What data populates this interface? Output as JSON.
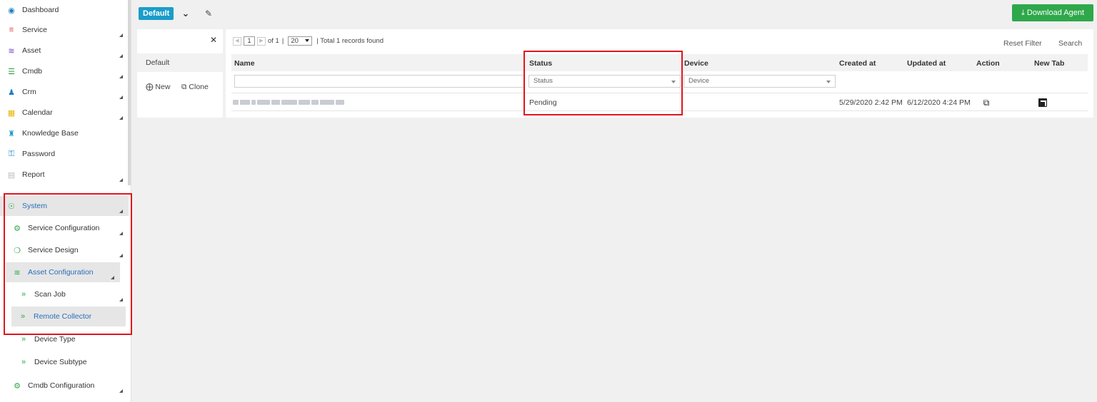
{
  "sidebar": {
    "items": [
      {
        "label": "Dashboard",
        "icon": "dashboard-icon",
        "color": "#1a7fc4"
      },
      {
        "label": "Service",
        "icon": "service-icon",
        "color": "#e23a3a"
      },
      {
        "label": "Asset",
        "icon": "wifi-icon",
        "color": "#7a3fc0"
      },
      {
        "label": "Cmdb",
        "icon": "database-icon",
        "color": "#2a9a3a"
      },
      {
        "label": "Crm",
        "icon": "user-icon",
        "color": "#1a7fc4"
      },
      {
        "label": "Calendar",
        "icon": "calendar-icon",
        "color": "#e8b400"
      },
      {
        "label": "Knowledge Base",
        "icon": "knowledge-icon",
        "color": "#1a9dc9"
      },
      {
        "label": "Password",
        "icon": "key-icon",
        "color": "#1a7fc4"
      },
      {
        "label": "Report",
        "icon": "report-icon",
        "color": "#bbbbbb"
      },
      {
        "label": "System",
        "icon": "globe-icon",
        "color": "#2ea84a"
      },
      {
        "label": "Service Configuration",
        "icon": "cogs-icon",
        "color": "#2ea84a"
      },
      {
        "label": "Service Design",
        "icon": "design-icon",
        "color": "#2ea84a"
      },
      {
        "label": "Asset Configuration",
        "icon": "wifi-icon",
        "color": "#2ea84a"
      },
      {
        "label": "Scan Job",
        "icon": "double-chevron-icon",
        "color": "#2ea84a"
      },
      {
        "label": "Remote Collector",
        "icon": "double-chevron-icon",
        "color": "#2ea84a"
      },
      {
        "label": "Device Type",
        "icon": "double-chevron-icon",
        "color": "#2ea84a"
      },
      {
        "label": "Device Subtype",
        "icon": "double-chevron-icon",
        "color": "#2ea84a"
      },
      {
        "label": "Cmdb Configuration",
        "icon": "cog-icon",
        "color": "#2ea84a"
      }
    ]
  },
  "topbar": {
    "view_label": "Default",
    "download_label": "Download Agent"
  },
  "views_panel": {
    "default_label": "Default",
    "new_label": "New",
    "clone_label": "Clone"
  },
  "pager": {
    "page": "1",
    "of_text": "of 1",
    "separator": "|",
    "page_size": "20",
    "total_text": "| Total 1 records found"
  },
  "toolbar": {
    "reset_filter": "Reset Filter",
    "search": "Search"
  },
  "table": {
    "headers": {
      "name": "Name",
      "status": "Status",
      "device": "Device",
      "created": "Created at",
      "updated": "Updated at",
      "action": "Action",
      "newtab": "New Tab"
    },
    "filters": {
      "status_placeholder": "Status",
      "device_placeholder": "Device"
    },
    "rows": [
      {
        "status": "Pending",
        "created": "5/29/2020 2:42 PM",
        "updated": "6/12/2020 4:24 PM"
      }
    ]
  },
  "colors": {
    "accent_blue": "#1a9dc9",
    "download_green": "#2ea84a",
    "highlight_red": "#e0141e",
    "link_blue": "#2a6ebb"
  }
}
